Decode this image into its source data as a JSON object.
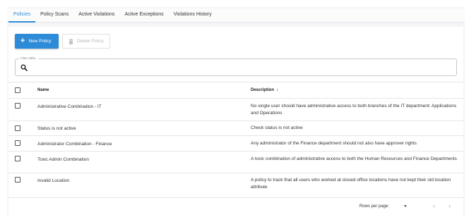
{
  "tabs": [
    {
      "label": "Policies",
      "active": true
    },
    {
      "label": "Policy Scans",
      "active": false
    },
    {
      "label": "Active Violations",
      "active": false
    },
    {
      "label": "Active Exceptions",
      "active": false
    },
    {
      "label": "Violations History",
      "active": false
    }
  ],
  "toolbar": {
    "new_label": "New Policy",
    "delete_label": "Delete Policy"
  },
  "filter": {
    "label": "Filter table..",
    "value": ""
  },
  "table": {
    "columns": {
      "name": "Name",
      "description": "Description",
      "sort_indicator": "↓"
    },
    "rows": [
      {
        "name": "Administrative Combination - IT",
        "description": "No single user should have administrative access to both branches of the IT department: Applications and Operations"
      },
      {
        "name": "Status is not active",
        "description": "Check status is not active"
      },
      {
        "name": "Administrator Combination - Finance",
        "description": "Any administrator of the Finance department should not also have approver rights"
      },
      {
        "name": "Toxic Admin Combination",
        "description": "A toxic combination of administrative access to both the Human Resources and Finance Departments"
      },
      {
        "name": "Invalid Location",
        "description": "A policy to track that all users who worked at closed office locations have not kept their old location attribute"
      }
    ]
  },
  "pagination": {
    "rows_per_page_label": "Rows per page:",
    "prev": "‹",
    "next": "›"
  },
  "colors": {
    "accent": "#2e8bd8",
    "disabled_text": "#b8b8b8"
  },
  "icons": {
    "new": "plus-icon",
    "delete": "trash-icon",
    "search": "search-icon",
    "dropdown": "caret-down-icon"
  }
}
